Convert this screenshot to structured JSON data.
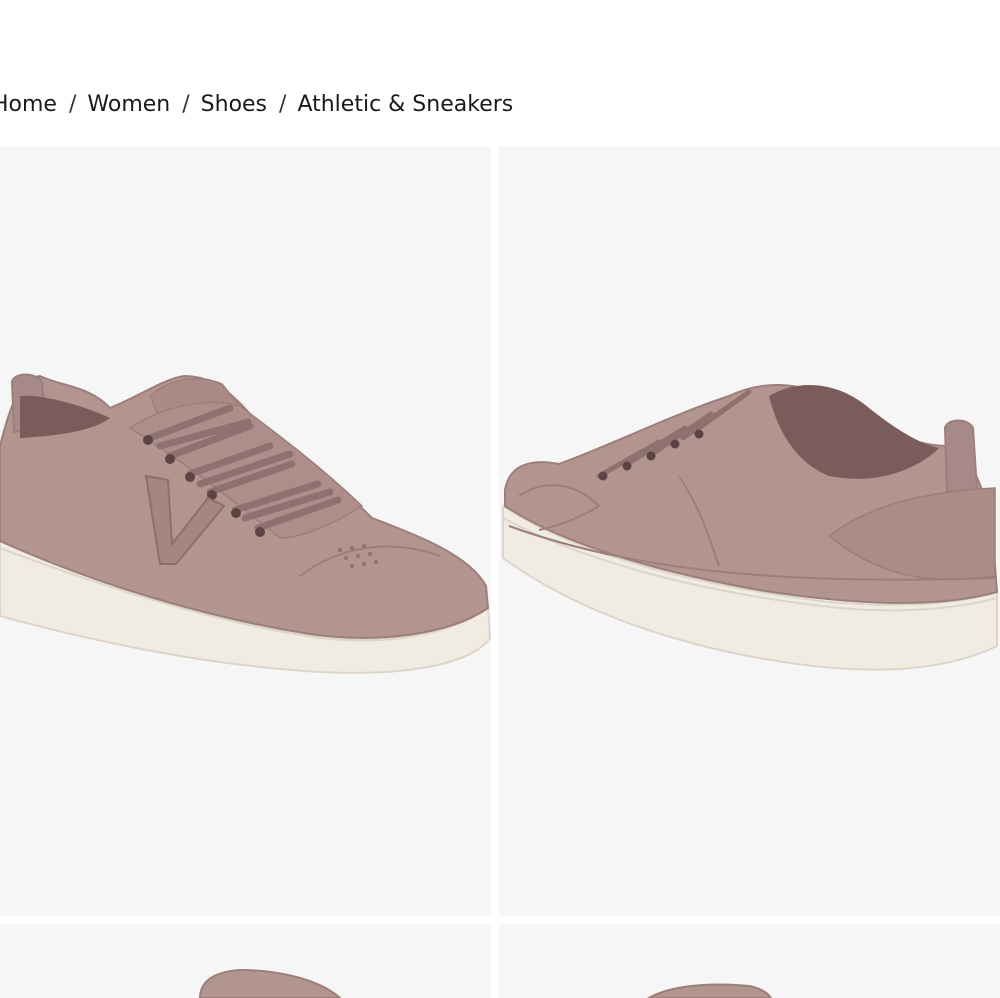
{
  "breadcrumb": {
    "items": [
      {
        "label": "Home"
      },
      {
        "label": "Women"
      },
      {
        "label": "Shoes"
      },
      {
        "label": "Athletic & Sneakers"
      }
    ],
    "separator": "/"
  },
  "gallery": {
    "images": [
      {
        "view": "front-three-quarter"
      },
      {
        "view": "rear-three-quarter"
      },
      {
        "view": "top"
      },
      {
        "view": "side"
      }
    ]
  },
  "colors": {
    "upper": "#b39590",
    "upper_shadow": "#9c7f7b",
    "lining": "#7a5c5b",
    "sole": "#f1ece3",
    "sole_shadow": "#ddd5c8",
    "background": "#f6f6f6",
    "text": "#1a1a1a"
  }
}
